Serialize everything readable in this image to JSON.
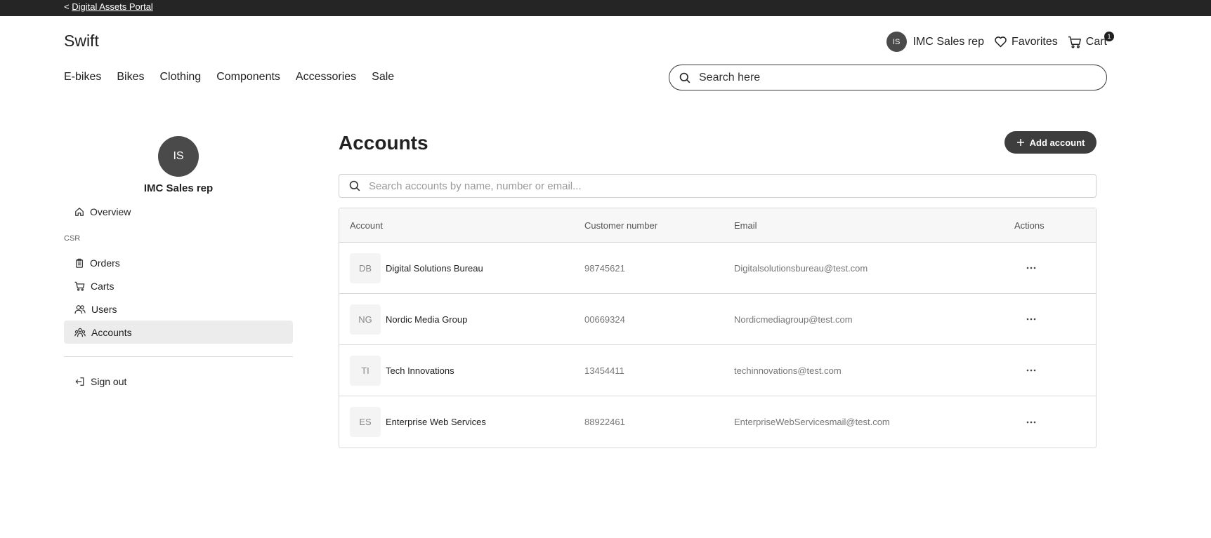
{
  "topbar": {
    "back_label": "< ",
    "portal_link": "Digital Assets Portal"
  },
  "header": {
    "brand": "Swift",
    "user": {
      "initials": "IS",
      "name": "IMC Sales rep"
    },
    "favorites_label": "Favorites",
    "cart_label": "Cart",
    "cart_count": "1"
  },
  "nav": {
    "categories": [
      "E-bikes",
      "Bikes",
      "Clothing",
      "Components",
      "Accessories",
      "Sale"
    ]
  },
  "site_search": {
    "placeholder": "Search here"
  },
  "sidebar": {
    "profile_initials": "IS",
    "profile_name": "IMC Sales rep",
    "overview_label": "Overview",
    "section_label": "CSR",
    "items": [
      {
        "label": "Orders",
        "icon": "clipboard-icon"
      },
      {
        "label": "Carts",
        "icon": "cart-icon"
      },
      {
        "label": "Users",
        "icon": "users-icon"
      },
      {
        "label": "Accounts",
        "icon": "accounts-icon",
        "active": true
      }
    ],
    "signout_label": "Sign out"
  },
  "main": {
    "title": "Accounts",
    "add_label": "Add account",
    "search_placeholder": "Search accounts by name, number or email...",
    "columns": [
      "Account",
      "Customer number",
      "Email",
      "Actions"
    ],
    "rows": [
      {
        "initials": "DB",
        "name": "Digital Solutions Bureau",
        "number": "98745621",
        "email": "Digitalsolutionsbureau@test.com"
      },
      {
        "initials": "NG",
        "name": "Nordic Media Group",
        "number": "00669324",
        "email": "Nordicmediagroup@test.com"
      },
      {
        "initials": "TI",
        "name": "Tech Innovations",
        "number": "13454411",
        "email": "techinnovations@test.com"
      },
      {
        "initials": "ES",
        "name": "Enterprise Web Services",
        "number": "88922461",
        "email": "EnterpriseWebServicesmail@test.com"
      }
    ]
  },
  "colors": {
    "topbar_bg": "#252525",
    "avatar_bg": "#4a4a4a",
    "primary_button": "#3d3d3d",
    "active_item_bg": "#ececec"
  }
}
